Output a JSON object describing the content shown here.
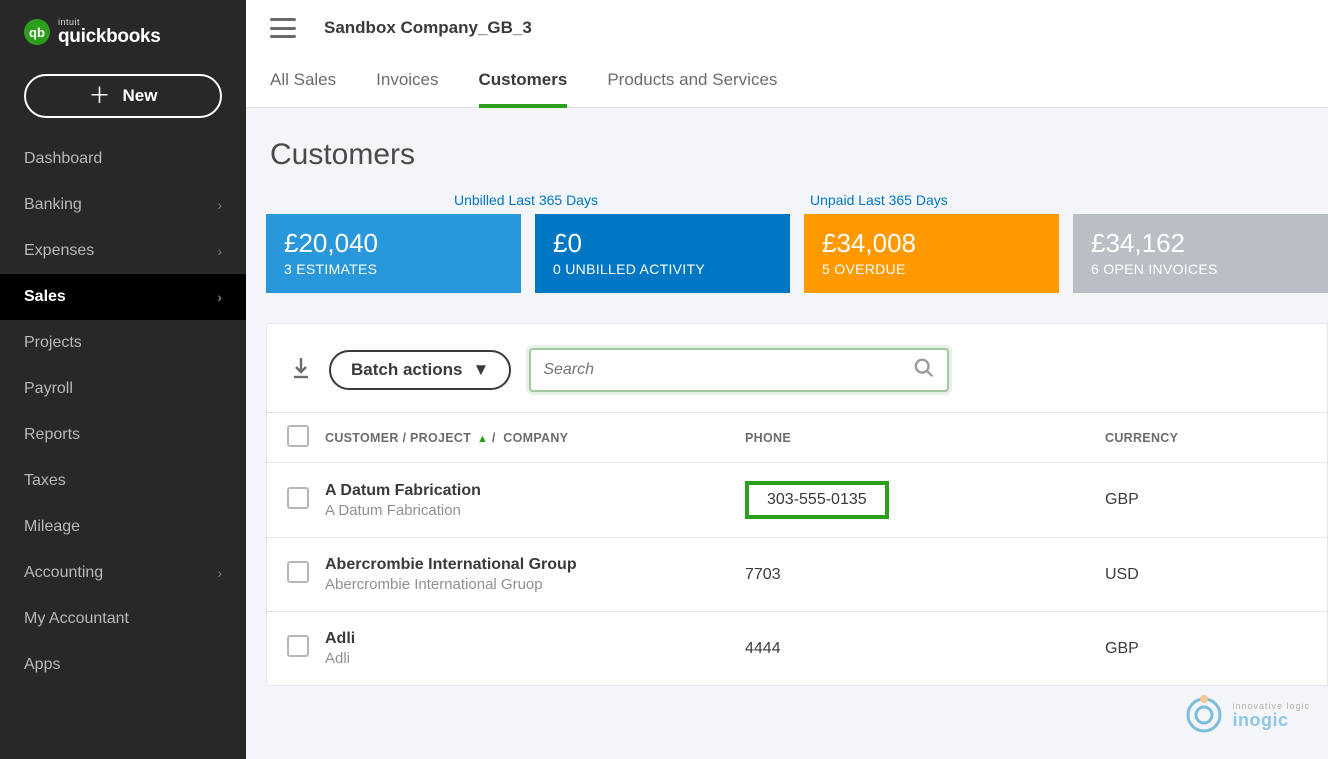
{
  "brand": {
    "product_small": "intuit",
    "product": "quickbooks",
    "logo_initials": "qb"
  },
  "sidebar": {
    "new_label": "New",
    "items": [
      {
        "label": "Dashboard",
        "has_submenu": false
      },
      {
        "label": "Banking",
        "has_submenu": true
      },
      {
        "label": "Expenses",
        "has_submenu": true
      },
      {
        "label": "Sales",
        "has_submenu": true,
        "active": true
      },
      {
        "label": "Projects",
        "has_submenu": false
      },
      {
        "label": "Payroll",
        "has_submenu": false
      },
      {
        "label": "Reports",
        "has_submenu": false
      },
      {
        "label": "Taxes",
        "has_submenu": false
      },
      {
        "label": "Mileage",
        "has_submenu": false
      },
      {
        "label": "Accounting",
        "has_submenu": true
      },
      {
        "label": "My Accountant",
        "has_submenu": false
      },
      {
        "label": "Apps",
        "has_submenu": false
      }
    ]
  },
  "header": {
    "company": "Sandbox Company_GB_3"
  },
  "tabs": {
    "items": [
      {
        "label": "All Sales"
      },
      {
        "label": "Invoices"
      },
      {
        "label": "Customers",
        "active": true
      },
      {
        "label": "Products and Services"
      }
    ]
  },
  "page": {
    "title": "Customers"
  },
  "stats": {
    "unbilled_header": "Unbilled Last 365 Days",
    "unpaid_header": "Unpaid Last 365 Days",
    "cards": [
      {
        "amount": "£20,040",
        "label": "3 ESTIMATES",
        "style": "light-blue"
      },
      {
        "amount": "£0",
        "label": "0 UNBILLED ACTIVITY",
        "style": "blue"
      },
      {
        "amount": "£34,008",
        "label": "5 OVERDUE",
        "style": "orange"
      },
      {
        "amount": "£34,162",
        "label": "6 OPEN INVOICES",
        "style": "gray"
      }
    ]
  },
  "toolbar": {
    "batch_label": "Batch actions",
    "search_placeholder": "Search"
  },
  "table": {
    "columns": {
      "customer": "CUSTOMER / PROJECT",
      "company": "COMPANY",
      "phone": "PHONE",
      "currency": "CURRENCY",
      "sep": "/"
    },
    "rows": [
      {
        "name": "A Datum Fabrication",
        "company": "A Datum Fabrication",
        "phone": "303-555-0135",
        "currency": "GBP",
        "highlight_phone": true
      },
      {
        "name": "Abercrombie International Group",
        "company": "Abercrombie International Gruop",
        "phone": "7703",
        "currency": "USD"
      },
      {
        "name": "Adli",
        "company": "Adli",
        "phone": "4444",
        "currency": "GBP"
      }
    ]
  },
  "watermark": {
    "tag": "innovative logic",
    "brand": "inogic"
  }
}
